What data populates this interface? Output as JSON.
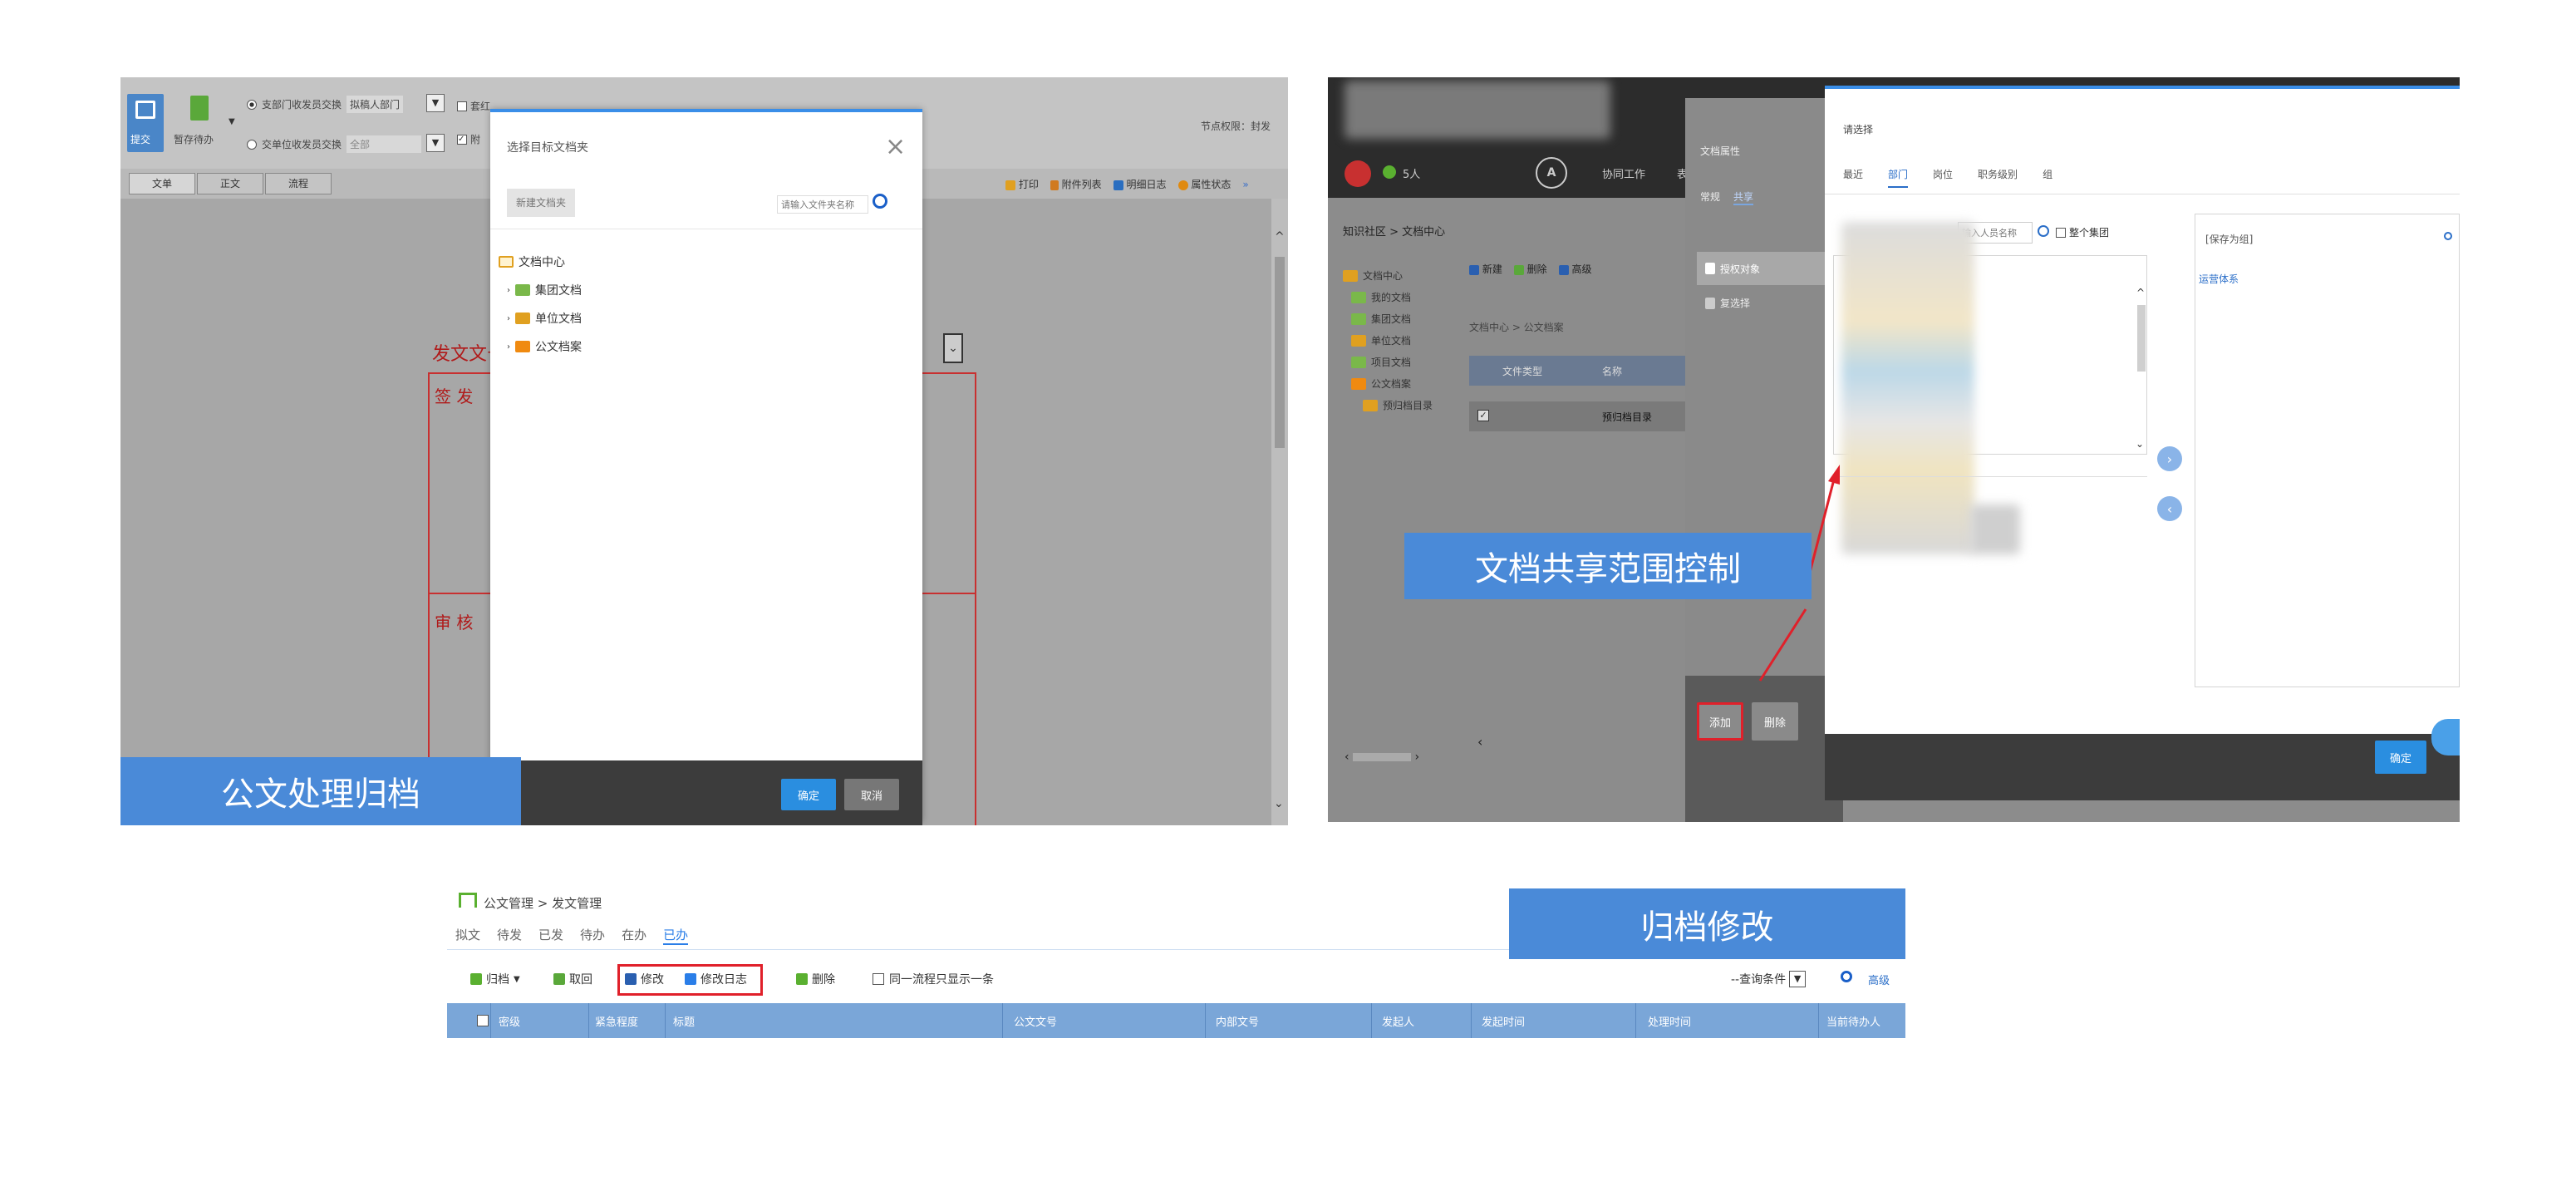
{
  "p1": {
    "toolbar": {
      "submit": "提交",
      "save_wait": "暂存待办",
      "radio1": "支部门收发员交换",
      "radio1_value": "拟稿人部门",
      "radio2": "交单位收发员交换",
      "radio2_value": "全部",
      "check1": "套红",
      "check2": "附",
      "right_status": "节点权限：封发",
      "print": "打印",
      "attach": "附件列表",
      "log": "明细日志",
      "attr": "属性状态"
    },
    "tabs": [
      "文单",
      "正文",
      "流程"
    ],
    "doc_label": "发文文号",
    "sign_label": "签 发",
    "review_label": "审 核",
    "dialog": {
      "title": "选择目标文档夹",
      "new_folder": "新建文档夹",
      "search_placeholder": "请输入文件夹名称",
      "tree": [
        "文档中心",
        "集团文档",
        "单位文档",
        "公文档案"
      ],
      "ok": "确定",
      "cancel": "取消"
    },
    "banner": "公文处理归档"
  },
  "p2": {
    "nav_tabs": [
      "协同工作",
      "表"
    ],
    "user_count": "5人",
    "breadcrumb": "知识社区 > 文档中心",
    "tree": [
      "文档中心",
      "我的文档",
      "集团文档",
      "单位文档",
      "项目文档",
      "公文档案",
      "预归档目录"
    ],
    "toolbar": [
      "新建",
      "删除",
      "高级"
    ],
    "path": "文档中心 > 公文档案",
    "table_headers": [
      "文件类型",
      "名称"
    ],
    "table_row": "预归档目录",
    "attr_panel": {
      "title": "文档属性",
      "tabs": [
        "常规",
        "共享"
      ],
      "items": [
        "授权对象",
        "复选择"
      ],
      "add": "添加",
      "delete": "删除"
    },
    "select_panel": {
      "title": "请选择",
      "tabs": [
        "最近",
        "部门",
        "岗位",
        "职务级别",
        "组"
      ],
      "search_placeholder": "输入人员名称",
      "whole_group": "整个集团",
      "selected_label": "[保存为组]",
      "selected_item": "运营体系",
      "ok": "确定"
    },
    "banner": "文档共享范围控制"
  },
  "p3": {
    "breadcrumb": "公文管理 > 发文管理",
    "tabs": [
      "拟文",
      "待发",
      "已发",
      "待办",
      "在办",
      "已办"
    ],
    "toolbar": {
      "archive": "归档",
      "cancel_archive": "取回",
      "modify": "修改",
      "modify_log": "修改日志",
      "delete": "删除",
      "one_only": "同一流程只显示一条",
      "query": "--查询条件",
      "advanced": "高级"
    },
    "headers": [
      "密级",
      "紧急程度",
      "标题",
      "公文文号",
      "内部文号",
      "发起人",
      "发起时间",
      "处理时间",
      "当前待办人"
    ],
    "banner": "归档修改"
  },
  "colors": {
    "banner": "#4a8ad8",
    "header_blue": "#7aa6d8",
    "highlight_red": "#e0202a",
    "gray_overlay": "#a9a9a9",
    "dark_bar": "#3c3c3c"
  }
}
